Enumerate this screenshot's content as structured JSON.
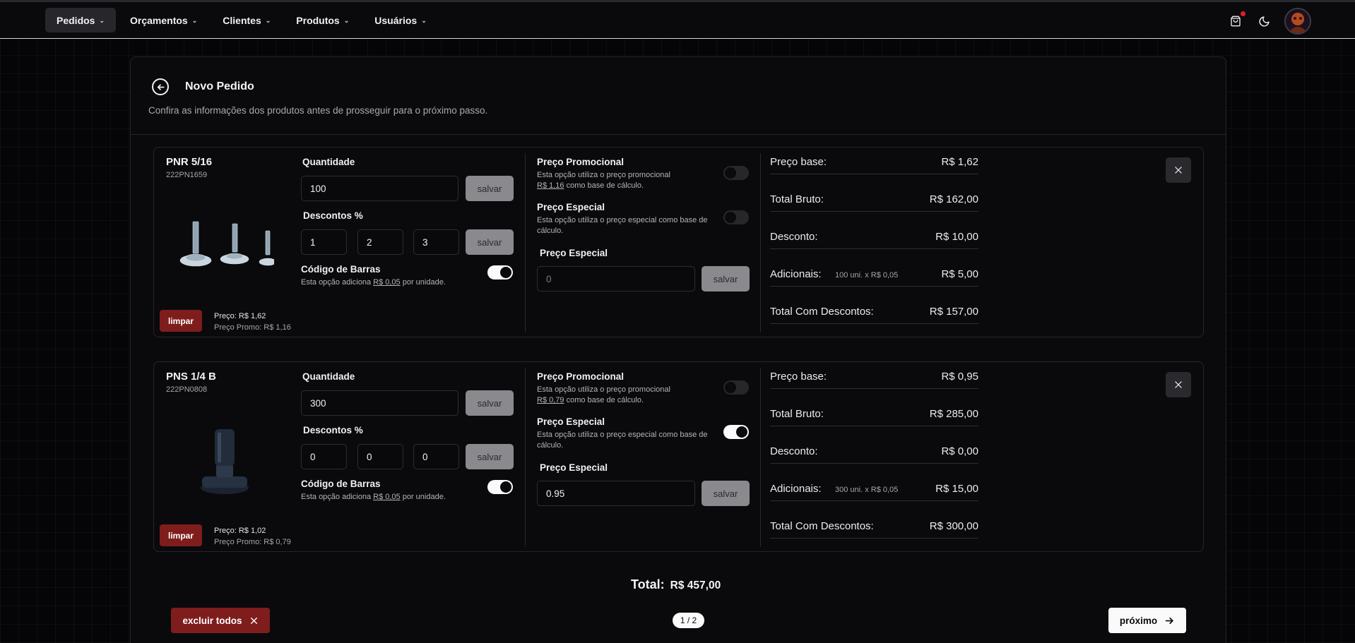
{
  "nav": {
    "items": [
      {
        "label": "Pedidos",
        "active": true
      },
      {
        "label": "Orçamentos",
        "active": false
      },
      {
        "label": "Clientes",
        "active": false
      },
      {
        "label": "Produtos",
        "active": false
      },
      {
        "label": "Usuários",
        "active": false
      }
    ],
    "icons": [
      "cart-icon",
      "moon-icon",
      "avatar"
    ]
  },
  "header": {
    "title": "Novo Pedido",
    "subtitle": "Confira as informações dos produtos antes de prosseguir para o próximo passo."
  },
  "labels": {
    "quantidade": "Quantidade",
    "descontos": "Descontos %",
    "codigo_barras": "Código de Barras",
    "codigo_barras_desc_pre": "Esta opção adiciona ",
    "codigo_barras_desc_link": "R$ 0,05",
    "codigo_barras_desc_post": " por unidade.",
    "preco_promocional": "Preço Promocional",
    "promo_desc_pre": "Esta opção utiliza o preço promocional",
    "promo_desc_post": " como base de cálculo.",
    "preco_especial": "Preço Especial",
    "especial_desc": "Esta opção utiliza o preço especial como base de cálculo.",
    "preco_especial_input": "Preço Especial",
    "salvar": "salvar",
    "limpar": "limpar",
    "preco_base": "Preço base:",
    "total_bruto": "Total Bruto:",
    "desconto": "Desconto:",
    "adicionais": "Adicionais:",
    "total_com_descontos": "Total Com Descontos:"
  },
  "products": [
    {
      "name": "PNR 5/16",
      "code": "222PN1659",
      "quantity": "100",
      "discounts": [
        "1",
        "2",
        "3"
      ],
      "barcode_on": true,
      "promo_price_link": "R$ 1,16",
      "promo_on": false,
      "special_on": false,
      "special_price_value": "",
      "special_price_placeholder": "0",
      "price_label": "Preço: R$ 1,62",
      "promo_label": "Preço Promo: R$ 1,16",
      "summary": {
        "preco_base": "R$ 1,62",
        "total_bruto": "R$ 162,00",
        "desconto": "R$ 10,00",
        "adicionais_note": "100 uni. x R$ 0,05",
        "adicionais": "R$ 5,00",
        "total_com_descontos": "R$ 157,00"
      }
    },
    {
      "name": "PNS 1/4 B",
      "code": "222PN0808",
      "quantity": "300",
      "discounts": [
        "0",
        "0",
        "0"
      ],
      "barcode_on": true,
      "promo_price_link": "R$ 0,79",
      "promo_on": false,
      "special_on": true,
      "special_price_value": "0.95",
      "special_price_placeholder": "",
      "price_label": "Preço: R$ 1,02",
      "promo_label": "Preço Promo: R$ 0,79",
      "summary": {
        "preco_base": "R$ 0,95",
        "total_bruto": "R$ 285,00",
        "desconto": "R$ 0,00",
        "adicionais_note": "300 uni. x R$ 0,05",
        "adicionais": "R$ 15,00",
        "total_com_descontos": "R$ 300,00"
      }
    }
  ],
  "footer": {
    "total_label": "Total:",
    "total_value": "R$ 457,00",
    "excluir_todos": "excluir todos",
    "pager": "1 / 2",
    "proximo": "próximo"
  },
  "colors": {
    "background": "#050507",
    "surface": "#0a0a0c",
    "danger": "#7f1d1d",
    "notification": "#e11d2e",
    "primary_button": "#fafafa"
  }
}
